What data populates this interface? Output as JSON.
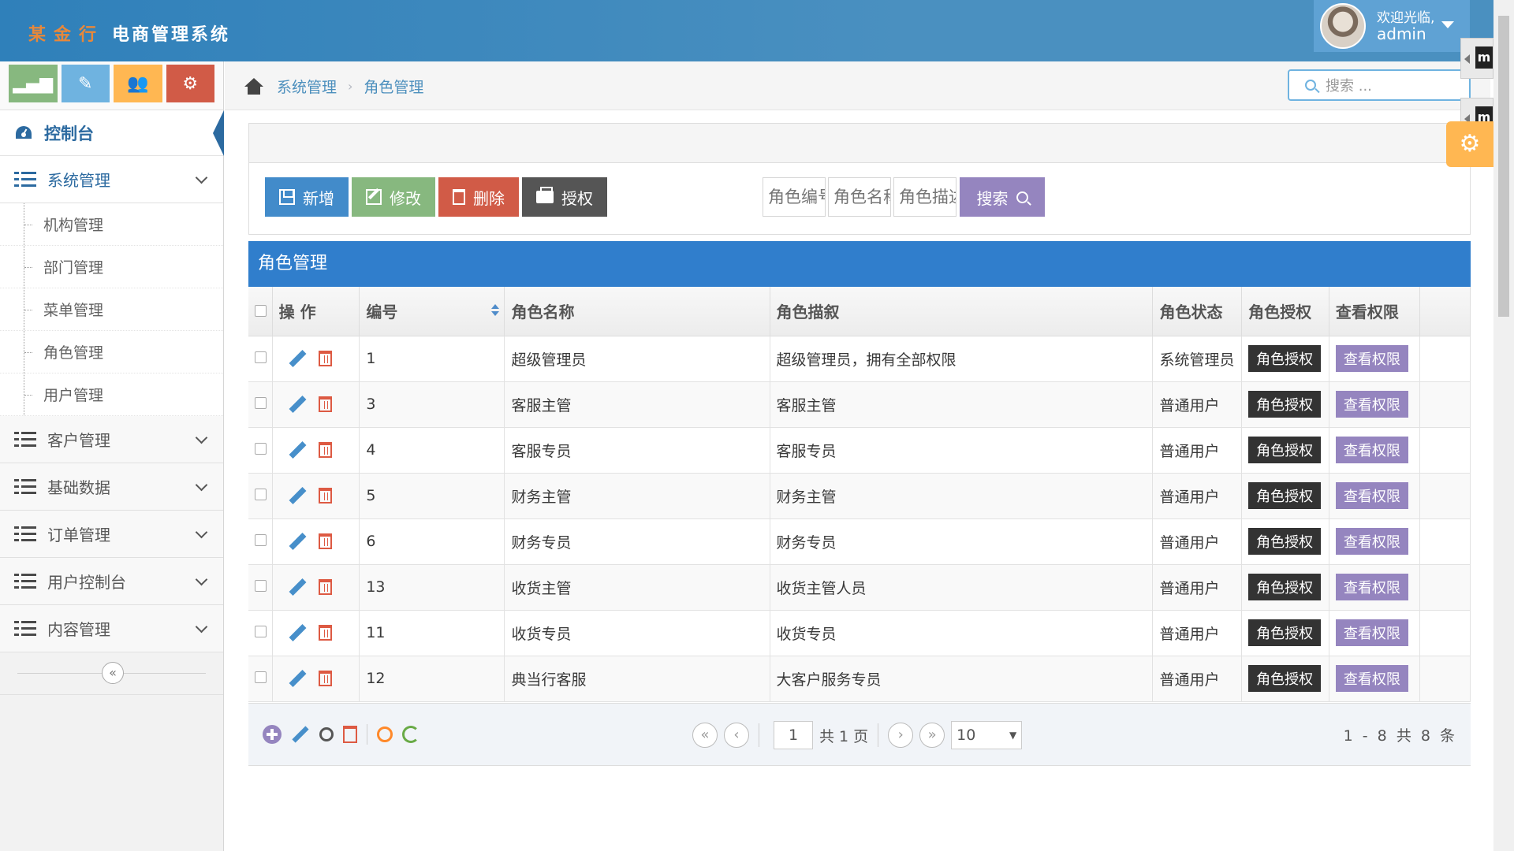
{
  "app": {
    "logo_text": "某金行",
    "title": "电商管理系统"
  },
  "user": {
    "welcome": "欢迎光临,",
    "name": "admin"
  },
  "shortcuts": [
    {
      "icon": "signal-icon",
      "glyph": "▂▄▆",
      "color": "#87b87f"
    },
    {
      "icon": "pencil-icon",
      "glyph": "✎",
      "color": "#6fb3e0"
    },
    {
      "icon": "group-icon",
      "glyph": "👥",
      "color": "#ffb752"
    },
    {
      "icon": "cogs-icon",
      "glyph": "⚙",
      "color": "#d15b47"
    }
  ],
  "sidebar": {
    "dashboard": "控制台",
    "groups": [
      {
        "label": "系统管理",
        "open": true,
        "items": [
          "机构管理",
          "部门管理",
          "菜单管理",
          "角色管理",
          "用户管理"
        ]
      },
      {
        "label": "客户管理"
      },
      {
        "label": "基础数据"
      },
      {
        "label": "订单管理"
      },
      {
        "label": "用户控制台"
      },
      {
        "label": "内容管理"
      }
    ],
    "collapse_glyph": "«"
  },
  "breadcrumb": {
    "items": [
      "系统管理",
      "角色管理"
    ],
    "search_placeholder": "搜索 ..."
  },
  "toolbar": {
    "add": "新增",
    "edit": "修改",
    "delete": "删除",
    "authorize": "授权",
    "filter_code": "角色编号",
    "filter_name": "角色名称",
    "filter_desc": "角色描述",
    "search": "搜索"
  },
  "grid": {
    "title": "角色管理",
    "columns": [
      "操 作",
      "编号",
      "角色名称",
      "角色描叙",
      "角色状态",
      "角色授权",
      "查看权限"
    ],
    "rows": [
      {
        "id": "1",
        "name": "超级管理员",
        "desc": "超级管理员，拥有全部权限",
        "status": "系统管理员"
      },
      {
        "id": "3",
        "name": "客服主管",
        "desc": "客服主管",
        "status": "普通用户"
      },
      {
        "id": "4",
        "name": "客服专员",
        "desc": "客服专员",
        "status": "普通用户"
      },
      {
        "id": "5",
        "name": "财务主管",
        "desc": "财务主管",
        "status": "普通用户"
      },
      {
        "id": "6",
        "name": "财务专员",
        "desc": "财务专员",
        "status": "普通用户"
      },
      {
        "id": "13",
        "name": "收货主管",
        "desc": "收货主管人员",
        "status": "普通用户"
      },
      {
        "id": "11",
        "name": "收货专员",
        "desc": "收货专员",
        "status": "普通用户"
      },
      {
        "id": "12",
        "name": "典当行客服",
        "desc": "大客户服务专员",
        "status": "普通用户"
      }
    ],
    "btn_authorize": "角色授权",
    "btn_view": "查看权限"
  },
  "pager": {
    "page": "1",
    "total_pages": "共 1 页",
    "page_size": "10",
    "range": "1 - 8",
    "total": "共 8 条"
  },
  "colors": {
    "navbar": "#2f80ba",
    "accent_blue": "#307ecc",
    "purple": "#9585bf"
  }
}
